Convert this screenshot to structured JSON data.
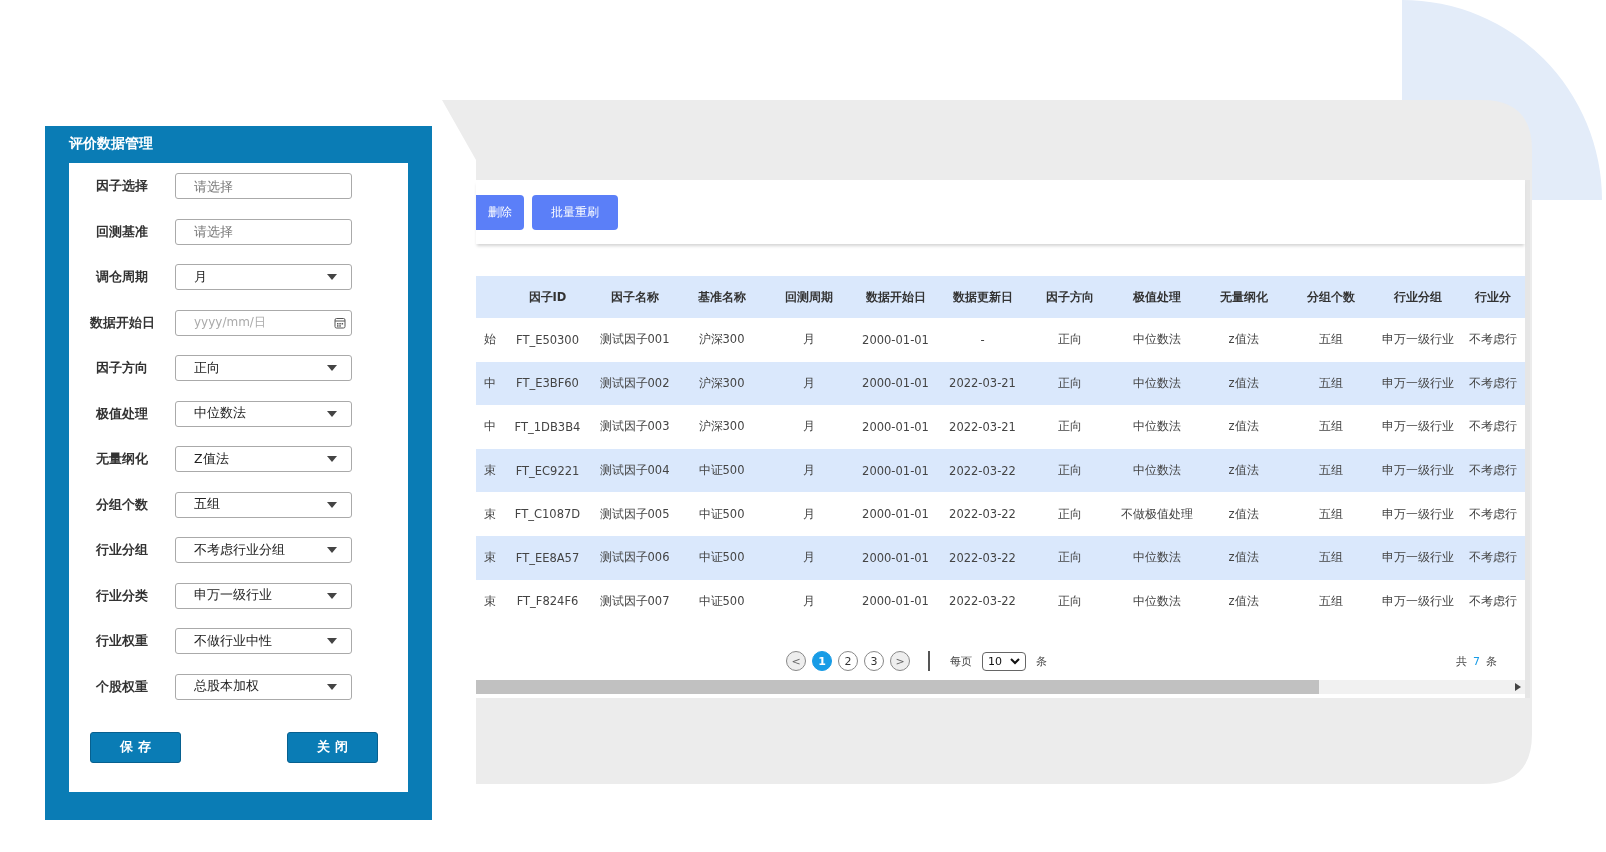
{
  "dialog": {
    "title": "评价数据管理",
    "fields": [
      {
        "label": "因子选择",
        "kind": "text",
        "placeholder": "请选择"
      },
      {
        "label": "回测基准",
        "kind": "text",
        "placeholder": "请选择"
      },
      {
        "label": "调仓周期",
        "kind": "select",
        "value": "月"
      },
      {
        "label": "数据开始日",
        "kind": "date",
        "placeholder": "yyyy/mm/日"
      },
      {
        "label": "因子方向",
        "kind": "select",
        "value": "正向"
      },
      {
        "label": "极值处理",
        "kind": "select",
        "value": "中位数法"
      },
      {
        "label": "无量纲化",
        "kind": "select",
        "value": "Z值法"
      },
      {
        "label": "分组个数",
        "kind": "select",
        "value": "五组"
      },
      {
        "label": "行业分组",
        "kind": "select",
        "value": "不考虑行业分组"
      },
      {
        "label": "行业分类",
        "kind": "select",
        "value": "申万一级行业"
      },
      {
        "label": "行业权重",
        "kind": "select",
        "value": "不做行业中性"
      },
      {
        "label": "个股权重",
        "kind": "select",
        "value": "总股本加权"
      }
    ],
    "buttons": [
      "保 存",
      "关 闭"
    ]
  },
  "toolbar": {
    "buttons": [
      "删除",
      "批量重刷"
    ]
  },
  "table": {
    "columns": [
      "",
      "因子ID",
      "因子名称",
      "基准名称",
      "回测周期",
      "数据开始日",
      "数据更新日",
      "因子方向",
      "极值处理",
      "无量纲化",
      "分组个数",
      "行业分组",
      "行业分"
    ],
    "rows": [
      [
        "始",
        "FT_E50300",
        "测试因子001",
        "沪深300",
        "月",
        "2000-01-01",
        "-",
        "正向",
        "中位数法",
        "z值法",
        "五组",
        "申万一级行业",
        "不考虑行"
      ],
      [
        "中",
        "FT_E3BF60",
        "测试因子002",
        "沪深300",
        "月",
        "2000-01-01",
        "2022-03-21",
        "正向",
        "中位数法",
        "z值法",
        "五组",
        "申万一级行业",
        "不考虑行"
      ],
      [
        "中",
        "FT_1DB3B4",
        "测试因子003",
        "沪深300",
        "月",
        "2000-01-01",
        "2022-03-21",
        "正向",
        "中位数法",
        "z值法",
        "五组",
        "申万一级行业",
        "不考虑行"
      ],
      [
        "束",
        "FT_EC9221",
        "测试因子004",
        "中证500",
        "月",
        "2000-01-01",
        "2022-03-22",
        "正向",
        "中位数法",
        "z值法",
        "五组",
        "申万一级行业",
        "不考虑行"
      ],
      [
        "束",
        "FT_C1087D",
        "测试因子005",
        "中证500",
        "月",
        "2000-01-01",
        "2022-03-22",
        "正向",
        "不做极值处理",
        "z值法",
        "五组",
        "申万一级行业",
        "不考虑行"
      ],
      [
        "束",
        "FT_EE8A57",
        "测试因子006",
        "中证500",
        "月",
        "2000-01-01",
        "2022-03-22",
        "正向",
        "中位数法",
        "z值法",
        "五组",
        "申万一级行业",
        "不考虑行"
      ],
      [
        "束",
        "FT_F824F6",
        "测试因子007",
        "中证500",
        "月",
        "2000-01-01",
        "2022-03-22",
        "正向",
        "中位数法",
        "z值法",
        "五组",
        "申万一级行业",
        "不考虑行"
      ]
    ]
  },
  "pagination": {
    "prev": "<",
    "next": ">",
    "pages": [
      {
        "label": "1",
        "selected": true
      },
      {
        "label": "2",
        "selected": false
      },
      {
        "label": "3",
        "selected": false
      }
    ],
    "per_page_label": "每页",
    "per_page": "10",
    "unit": "条",
    "total_prefix": "共",
    "total": "7",
    "total_suffix": "条"
  }
}
